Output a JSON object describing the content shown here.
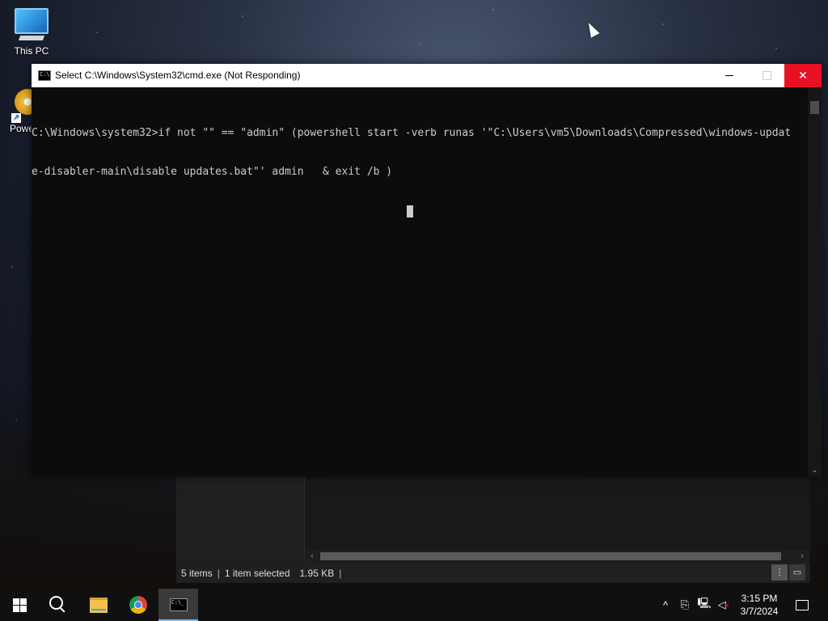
{
  "desktop": {
    "icons": [
      {
        "label": "This PC"
      },
      {
        "label": "Powe"
      }
    ]
  },
  "cmd_window": {
    "title": "Select C:\\Windows\\System32\\cmd.exe (Not Responding)",
    "lines": [
      "C:\\Windows\\system32>if not \"\" == \"admin\" (powershell start -verb runas '\"C:\\Users\\vm5\\Downloads\\Compressed\\windows-updat",
      "e-disabler-main\\disable updates.bat\"' admin   & exit /b )"
    ]
  },
  "explorer_status": {
    "items": "5 items",
    "selected": "1 item selected",
    "size": "1.95 KB"
  },
  "taskbar": {
    "pinned": [
      "start-icon",
      "search-icon",
      "file-explorer-icon",
      "chrome-icon",
      "cmd-icon"
    ],
    "clock_time": "3:15 PM",
    "clock_date": "3/7/2024",
    "tray_icons": [
      "chevron-up-icon",
      "network-icon",
      "network-icon",
      "volume-muted-icon"
    ]
  },
  "colors": {
    "close_button": "#e81123",
    "console_bg": "#0c0c0c",
    "console_text": "#cccccc",
    "taskbar_bg": "#101010"
  }
}
